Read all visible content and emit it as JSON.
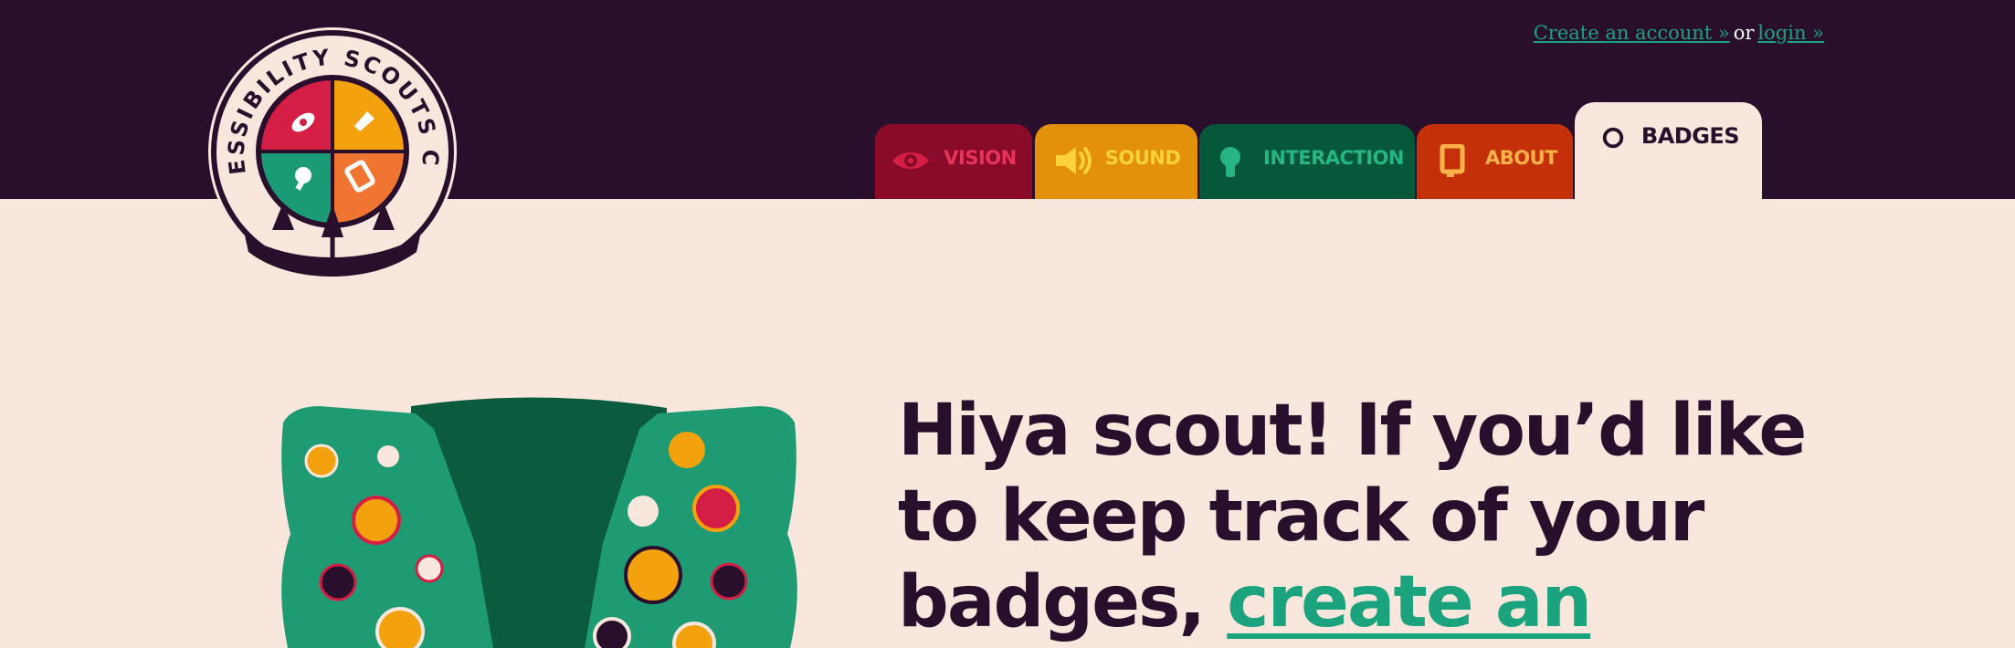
{
  "header": {
    "create_account_link": "Create an account »",
    "or_text": "or",
    "login_link": "login »"
  },
  "logo": {
    "text": "ACCESSIBILITY SCOUTS CAMP"
  },
  "nav": {
    "tabs": [
      {
        "label": "VISION",
        "icon": "eye-icon"
      },
      {
        "label": "SOUND",
        "icon": "speaker-icon"
      },
      {
        "label": "INTERACTION",
        "icon": "pointer-icon"
      },
      {
        "label": "ABOUT",
        "icon": "info-card-icon"
      },
      {
        "label": "BADGES",
        "icon": "badge-circle-icon",
        "active": true
      }
    ]
  },
  "hero": {
    "text_before": "Hiya scout! If you’d like to keep track of your badges, ",
    "link_text": "create an"
  },
  "colors": {
    "header_bg": "#2a0f2d",
    "page_bg": "#f9e6dc",
    "accent_green": "#1aa37d",
    "vision": "#8a0a2a",
    "sound": "#e3900a",
    "interaction": "#06583b",
    "about": "#c4300a"
  }
}
